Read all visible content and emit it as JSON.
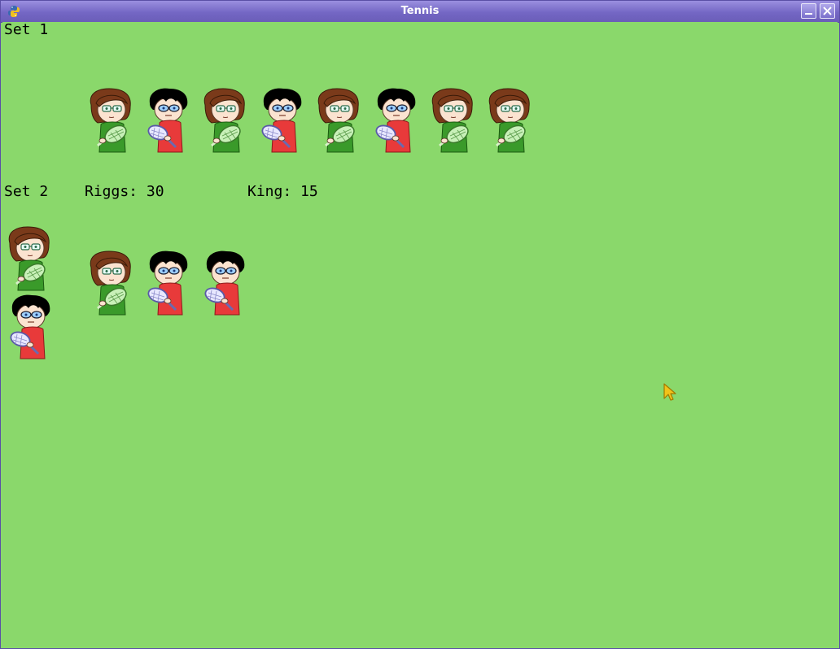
{
  "window": {
    "title": "Tennis",
    "app_icon": "python-icon",
    "controls": [
      "minimize-icon",
      "close-icon"
    ]
  },
  "colors": {
    "field": "#8ad86b",
    "titlebar": "#7467c4",
    "text": "#000000",
    "king_shirt": "#3a9a2a",
    "riggs_shirt": "#e83a3a",
    "king_hair": "#7a3a1a",
    "riggs_hair": "#000000"
  },
  "set1": {
    "label": "Set 1",
    "points": [
      "king",
      "riggs",
      "king",
      "riggs",
      "king",
      "riggs",
      "king",
      "king"
    ]
  },
  "set2": {
    "label": "Set 2",
    "score": {
      "riggs": "Riggs: 30",
      "king": "King: 15"
    },
    "serve_stack": [
      "king",
      "riggs"
    ],
    "points": [
      "king",
      "riggs",
      "riggs"
    ]
  },
  "cursor": "pointer-arrow-icon"
}
